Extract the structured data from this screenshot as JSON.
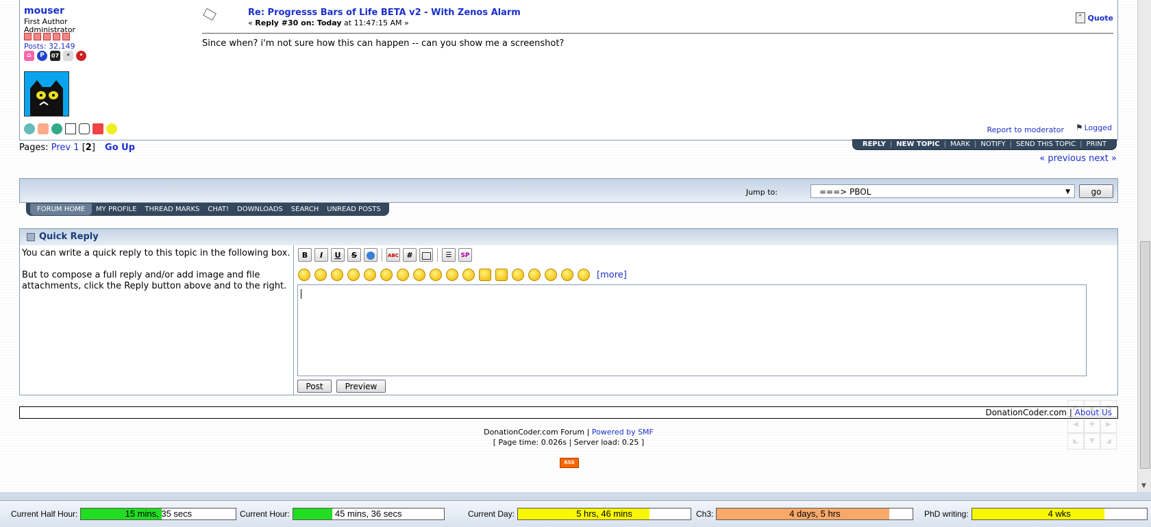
{
  "post": {
    "author": "mouser",
    "author_title": "First Author",
    "author_group": "Administrator",
    "posts_count": "Posts: 32,149",
    "badge_year": "07",
    "title": "Re: Progresss Bars of Life BETA v2 - With Zenos Alarm",
    "sub_prefix": "« ",
    "sub_reply": "Reply #30 on: Today",
    "sub_time": " at 11:47:15 AM »",
    "quote": "Quote",
    "body": "Since when? i'm not sure how this can happen -- can you show me a screenshot?",
    "report": "Report to moderator",
    "logged": "Logged"
  },
  "pages": {
    "label": "Pages: ",
    "prev": "Prev",
    "page1": "1",
    "current": "2",
    "go_up": "Go Up"
  },
  "topic_buttons": [
    "REPLY",
    "NEW TOPIC",
    "MARK",
    "NOTIFY",
    "SEND THIS TOPIC",
    "PRINT"
  ],
  "prev_next": {
    "prev": "« previous",
    "next": "next »"
  },
  "jump": {
    "label": "Jump to:",
    "selected": "===> PBOL",
    "go": "go"
  },
  "nav": [
    "FORUM HOME",
    "MY PROFILE",
    "THREAD MARKS",
    "CHAT!",
    "DOWNLOADS",
    "SEARCH",
    "UNREAD POSTS"
  ],
  "quick_reply": {
    "title": "Quick Reply",
    "help1": "You can write a quick reply to this topic in the following box.",
    "help2": "But to compose a full reply and/or add image and file attachments, click the Reply button above and to the right.",
    "more": "[more]",
    "post": "Post",
    "preview": "Preview",
    "tools": [
      "B",
      "I",
      "U",
      "S",
      "globe",
      "ABC",
      "#",
      "quote",
      "list",
      "SP"
    ]
  },
  "footer": {
    "site": "DonationCoder.com",
    "about": "About Us",
    "forum": "DonationCoder.com Forum",
    "powered": "Powered by SMF",
    "stats": "[ Page time: 0.026s | Server load: 0.25 ]",
    "rss": "RSS"
  },
  "status": [
    {
      "label": "Current Half Hour:",
      "value": "15 mins, 35 secs",
      "fill": 0.52,
      "color": "#22dd22"
    },
    {
      "label": "Current Hour:",
      "value": "45 mins, 36 secs",
      "fill": 0.26,
      "color": "#22dd22"
    },
    {
      "label": "Current Day:",
      "value": "5 hrs, 46 mins",
      "fill": 0.76,
      "color": "#f8f800"
    },
    {
      "label": "Ch3:",
      "value": "4 days, 5 hrs",
      "fill": 0.88,
      "color": "#f8a868"
    },
    {
      "label": "PhD writing:",
      "value": "4 wks",
      "fill": 0.76,
      "color": "#f8f800"
    }
  ]
}
